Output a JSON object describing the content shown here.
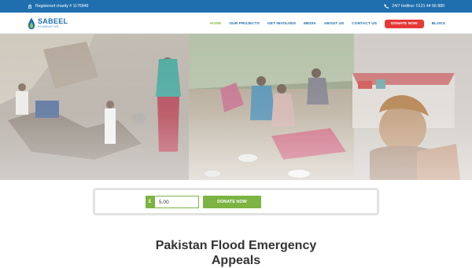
{
  "topbar": {
    "charity_text": "Registered charity # 1176949",
    "hotline_text": "24/7 Hotline: 0121 44 66 880"
  },
  "header": {
    "logo": {
      "title": "SABEEL",
      "subtitle": "FOUNDATION"
    },
    "nav": [
      {
        "label": "HOME",
        "active": true
      },
      {
        "label": "OUR PROJECTS",
        "active": false
      },
      {
        "label": "GET INVOLVED",
        "active": false
      },
      {
        "label": "MEDIA",
        "active": false
      },
      {
        "label": "ABOUT US",
        "active": false
      },
      {
        "label": "CONTACT US",
        "active": false
      },
      {
        "label": "DONATE NOW",
        "active": false,
        "style": "button"
      },
      {
        "label": "BLOGS",
        "active": false
      }
    ]
  },
  "donate": {
    "currency": "£",
    "amount": "5.00",
    "button_label": "DONATE NOW"
  },
  "page_title": {
    "line1": "Pakistan Flood Emergency",
    "line2": "Appeals"
  },
  "colors": {
    "primary": "#1f6fae",
    "accent_green": "#7cb342",
    "nav_active": "#8bc34a",
    "donate_red": "#e53935"
  }
}
